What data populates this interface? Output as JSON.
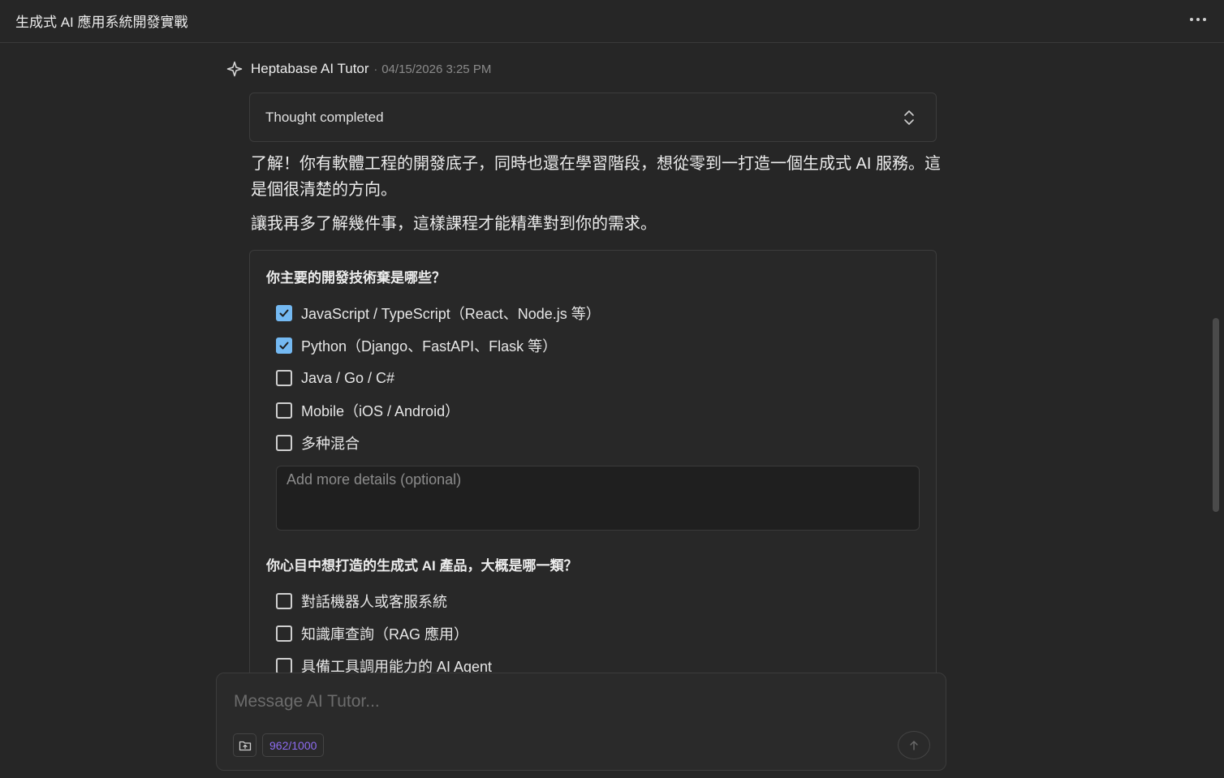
{
  "header": {
    "title": "生成式 AI 應用系統開發實戰",
    "more_icon": "more-horizontal-icon"
  },
  "message": {
    "author": "Heptabase AI Tutor",
    "separator": "·",
    "timestamp": "04/15/2026 3:25 PM",
    "thought_label": "Thought completed",
    "paragraphs": [
      "了解！你有軟體工程的開發底子，同時也還在學習階段，想從零到一打造一個生成式 AI 服務。這是個很清楚的方向。",
      "讓我再多了解幾件事，這樣課程才能精準對到你的需求。"
    ]
  },
  "form": {
    "q1": {
      "title": "你主要的開發技術棄是哪些？",
      "options": [
        {
          "label": "JavaScript / TypeScript（React、Node.js 等）",
          "checked": true
        },
        {
          "label": "Python（Django、FastAPI、Flask 等）",
          "checked": true
        },
        {
          "label": "Java / Go / C#",
          "checked": false
        },
        {
          "label": "Mobile（iOS / Android）",
          "checked": false
        },
        {
          "label": "多种混合",
          "checked": false
        }
      ],
      "details_placeholder": "Add more details (optional)"
    },
    "q2": {
      "title": "你心目中想打造的生成式 AI 產品，大概是哪一類？",
      "options": [
        {
          "label": "對話機器人或客服系統",
          "checked": false
        },
        {
          "label": "知識庫查詢（RAG 應用）",
          "checked": false
        },
        {
          "label": "具備工具調用能力的 AI Agent",
          "checked": false
        }
      ]
    }
  },
  "composer": {
    "placeholder": "Message AI Tutor...",
    "char_count": "962/1000"
  },
  "colors": {
    "accent_checkbox": "#74b9f2",
    "counter": "#8d6cf0"
  }
}
